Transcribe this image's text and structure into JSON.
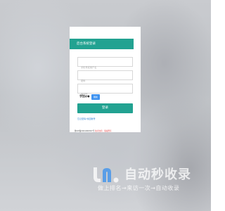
{
  "login": {
    "title": "后台系统登录",
    "username_placeholder": "手机号或用户名",
    "password_placeholder": "密码",
    "captcha_placeholder": "验证码",
    "captcha_text": "字加ォ●",
    "refresh_label": "刷新",
    "submit_label": "登录",
    "forgot_link": "忘记密码?找回账号"
  },
  "footer": {
    "copyright": "鲁ICP备2021000327号",
    "sep": " ",
    "link_a": "技术支持",
    "link_b": "：版权所有"
  },
  "watermark": {
    "title": "自动秒收录",
    "subtitle": "做上排名→来访一次→自动收录"
  }
}
